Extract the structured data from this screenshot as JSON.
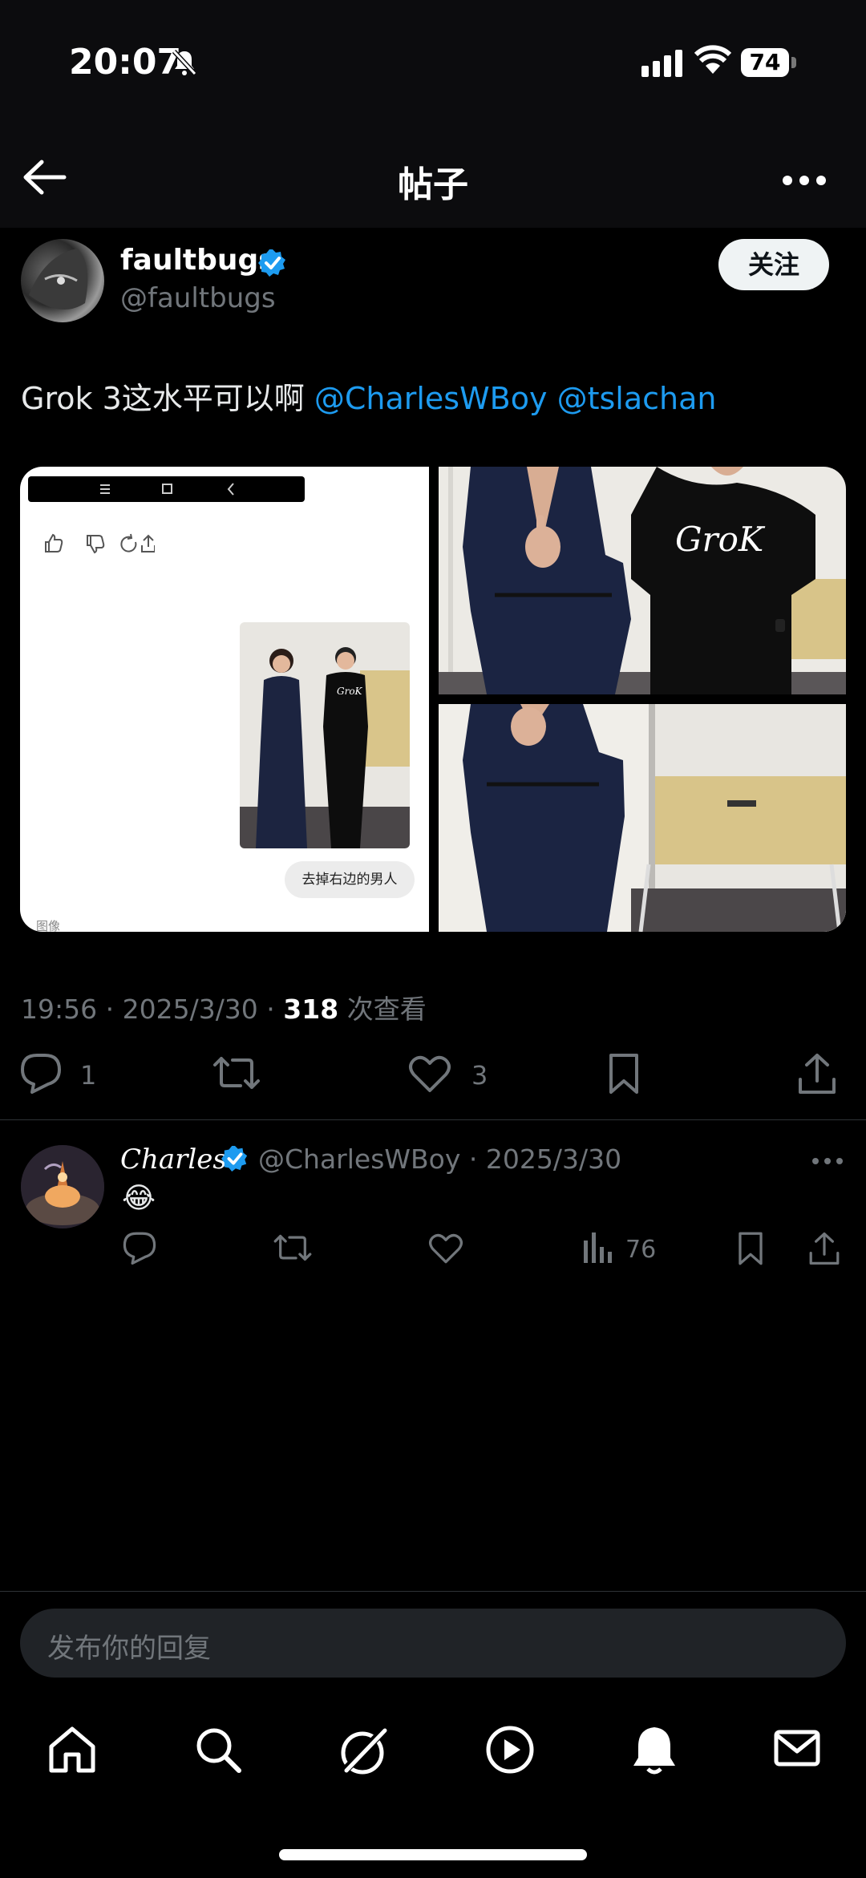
{
  "status": {
    "time": "20:07",
    "battery": "74"
  },
  "nav": {
    "title": "帖子"
  },
  "post": {
    "author_name": "faultbugs",
    "author_handle": "@faultbugs",
    "follow_label": "关注",
    "text": "Grok 3这水平可以啊 ",
    "mention_1": "@CharlesWBoy",
    "mention_2": "@tslachan",
    "media": {
      "bubble_text": "去掉右边的男人",
      "tiny_label": "图像",
      "shirt_logo": "GroK"
    },
    "time": "19:56",
    "date": "2025/3/30",
    "views": "318",
    "views_label": "次查看",
    "reply_count": "1",
    "like_count": "3"
  },
  "reply": {
    "name": "Charles",
    "meta": "@CharlesWBoy · 2025/3/30",
    "emoji": "😂",
    "view_count": "76"
  },
  "composer": {
    "placeholder": "发布你的回复"
  },
  "colors": {
    "accent": "#1d9bf0",
    "muted": "#71767b",
    "background": "#000000"
  },
  "icons": [
    "back-icon",
    "more-icon",
    "verified-icon",
    "reply-icon",
    "repost-icon",
    "like-icon",
    "bookmark-icon",
    "share-icon",
    "views-icon",
    "home-icon",
    "search-icon",
    "grok-icon",
    "video-icon",
    "notifications-icon",
    "messages-icon"
  ]
}
